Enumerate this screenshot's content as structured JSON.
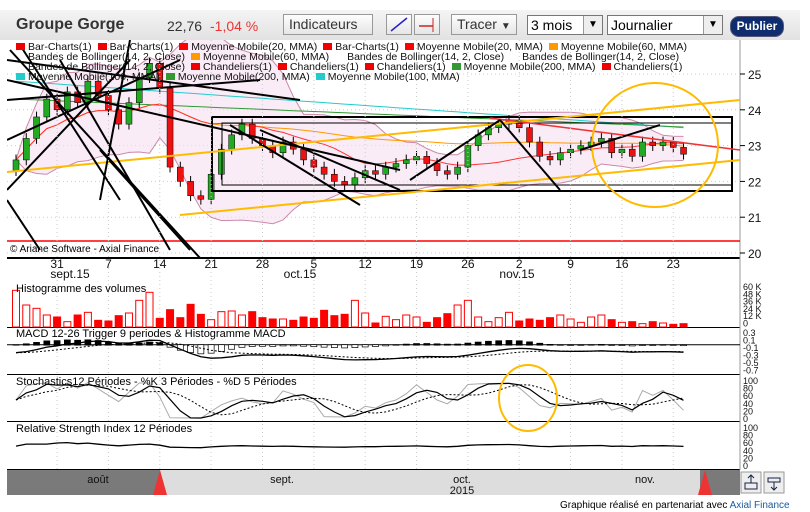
{
  "header": {
    "title": "Groupe Gorge",
    "price": "22,76",
    "change": "-1,04 %",
    "indicators_label": "Indicateurs",
    "draw_label": "Tracer",
    "period": "3 mois",
    "interval": "Journalier",
    "publish_label": "Publier"
  },
  "legend": [
    [
      {
        "label": "Bar-Charts(1)",
        "color": "#e00"
      },
      {
        "label": "Bar-Charts(1)",
        "color": "#e00"
      },
      {
        "label": "Moyenne Mobile(20, MMA)",
        "color": "#f00"
      },
      {
        "label": "Bar-Charts(1)",
        "color": "#e00"
      },
      {
        "label": "Moyenne Mobile(20, MMA)",
        "color": "#f00"
      },
      {
        "label": "Moyenne Mobile(60, MMA)",
        "color": "#f90"
      }
    ],
    [
      {
        "label": "Bandes de Bollinger(14, 2, Close)",
        "color": ""
      },
      {
        "label": "Moyenne Mobile(60, MMA)",
        "color": "#f90"
      },
      {
        "label": "Bandes de Bollinger(14, 2, Close)",
        "color": ""
      },
      {
        "label": "Bandes de Bollinger(14, 2, Close)",
        "color": ""
      }
    ],
    [
      {
        "label": "Bandes de Bollinger(14, 2, Close)",
        "color": ""
      },
      {
        "label": "Chandeliers(1)",
        "color": "#e00"
      },
      {
        "label": "Chandeliers(1)",
        "color": "#e00"
      },
      {
        "label": "Chandeliers(1)",
        "color": "#e00"
      },
      {
        "label": "Moyenne Mobile(200, MMA)",
        "color": "#393"
      },
      {
        "label": "Chandeliers(1)",
        "color": "#e00"
      }
    ],
    [
      {
        "label": "Moyenne Mobile(100, MMA)",
        "color": "#2cc"
      },
      {
        "label": "Moyenne Mobile(200, MMA)",
        "color": "#393"
      },
      {
        "label": "Moyenne Mobile(100, MMA)",
        "color": "#2cc"
      }
    ]
  ],
  "copyright": "© Ariane Software - Axial Finance",
  "panels": {
    "volume": "Histogramme des volumes",
    "macd": "MACD 12-26   Trigger 9 periodes & Histogramme MACD",
    "stoch": "Stochastics12 Périodes  -  %K 3 Périodes  -  %D 5 Périodes",
    "rsi": "Relative Strength Index 12 Périodes"
  },
  "navigator": {
    "months": [
      "août",
      "sept.",
      "oct.",
      "nov."
    ],
    "year": "2015"
  },
  "footer": {
    "text": "Graphique réalisé en partenariat avec ",
    "link": "Axial Finance"
  },
  "chart_data": {
    "type": "candlestick",
    "x_ticks": [
      "31",
      "7",
      "14",
      "21",
      "28",
      "5",
      "12",
      "19",
      "26",
      "2",
      "9",
      "16",
      "23"
    ],
    "month_labels": [
      "sept.15",
      "oct.15",
      "nov.15"
    ],
    "y_ticks": [
      "25",
      "24",
      "23",
      "22",
      "21",
      "20"
    ],
    "ylim": [
      20,
      25.9
    ],
    "volume_ticks": [
      "60 K",
      "48 K",
      "36 K",
      "24 K",
      "12 K",
      "0"
    ],
    "macd_ticks": [
      "0.3",
      "0.1",
      "-0.1",
      "-0.3",
      "-0.5",
      "-0.7"
    ],
    "osc_ticks": [
      "100",
      "80",
      "60",
      "40",
      "20",
      "0"
    ],
    "closes": [
      22.6,
      23.2,
      23.8,
      24.3,
      24.0,
      24.5,
      24.2,
      24.8,
      24.4,
      24.0,
      23.6,
      24.2,
      24.9,
      25.3,
      24.6,
      22.4,
      22.0,
      21.6,
      21.5,
      22.2,
      22.9,
      23.3,
      23.6,
      23.2,
      23.0,
      22.8,
      23.1,
      22.9,
      22.6,
      22.4,
      22.2,
      22.0,
      21.9,
      22.1,
      22.3,
      22.2,
      22.4,
      22.5,
      22.6,
      22.7,
      22.5,
      22.3,
      22.2,
      22.4,
      23.0,
      23.3,
      23.5,
      23.6,
      23.7,
      23.5,
      23.1,
      22.7,
      22.6,
      22.8,
      22.9,
      23.0,
      23.1,
      23.2,
      22.8,
      22.9,
      22.7,
      23.1,
      23.0,
      23.1,
      22.95,
      22.76
    ],
    "volumes_k": [
      55,
      33,
      28,
      18,
      15,
      8,
      18,
      22,
      10,
      9,
      17,
      21,
      40,
      52,
      13,
      26,
      14,
      34,
      19,
      11,
      23,
      24,
      18,
      23,
      14,
      12,
      12,
      10,
      15,
      13,
      25,
      17,
      19,
      40,
      21,
      6,
      16,
      11,
      18,
      15,
      7,
      14,
      20,
      33,
      40,
      15,
      8,
      14,
      22,
      9,
      12,
      10,
      14,
      18,
      12,
      7,
      15,
      18,
      11,
      7,
      8,
      5,
      8,
      6,
      4,
      5
    ]
  }
}
